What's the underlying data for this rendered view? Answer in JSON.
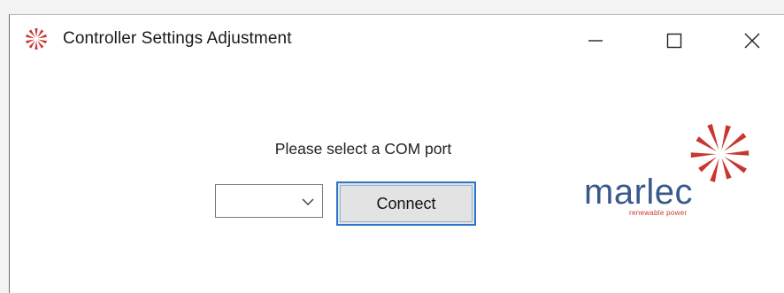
{
  "window": {
    "title": "Controller Settings Adjustment",
    "app_icon": "marlec-burst-icon",
    "controls": [
      "minimize-icon",
      "maximize-icon",
      "close-icon"
    ]
  },
  "form": {
    "prompt": "Please select a COM port",
    "com_port_selected": "",
    "connect_label": "Connect"
  },
  "branding": {
    "logo_text": "marlec",
    "tagline": "renewable power",
    "colors": {
      "logo_blue": "#3a5a8c",
      "logo_red": "#c8362e",
      "focus_blue": "#2b77c9"
    }
  }
}
